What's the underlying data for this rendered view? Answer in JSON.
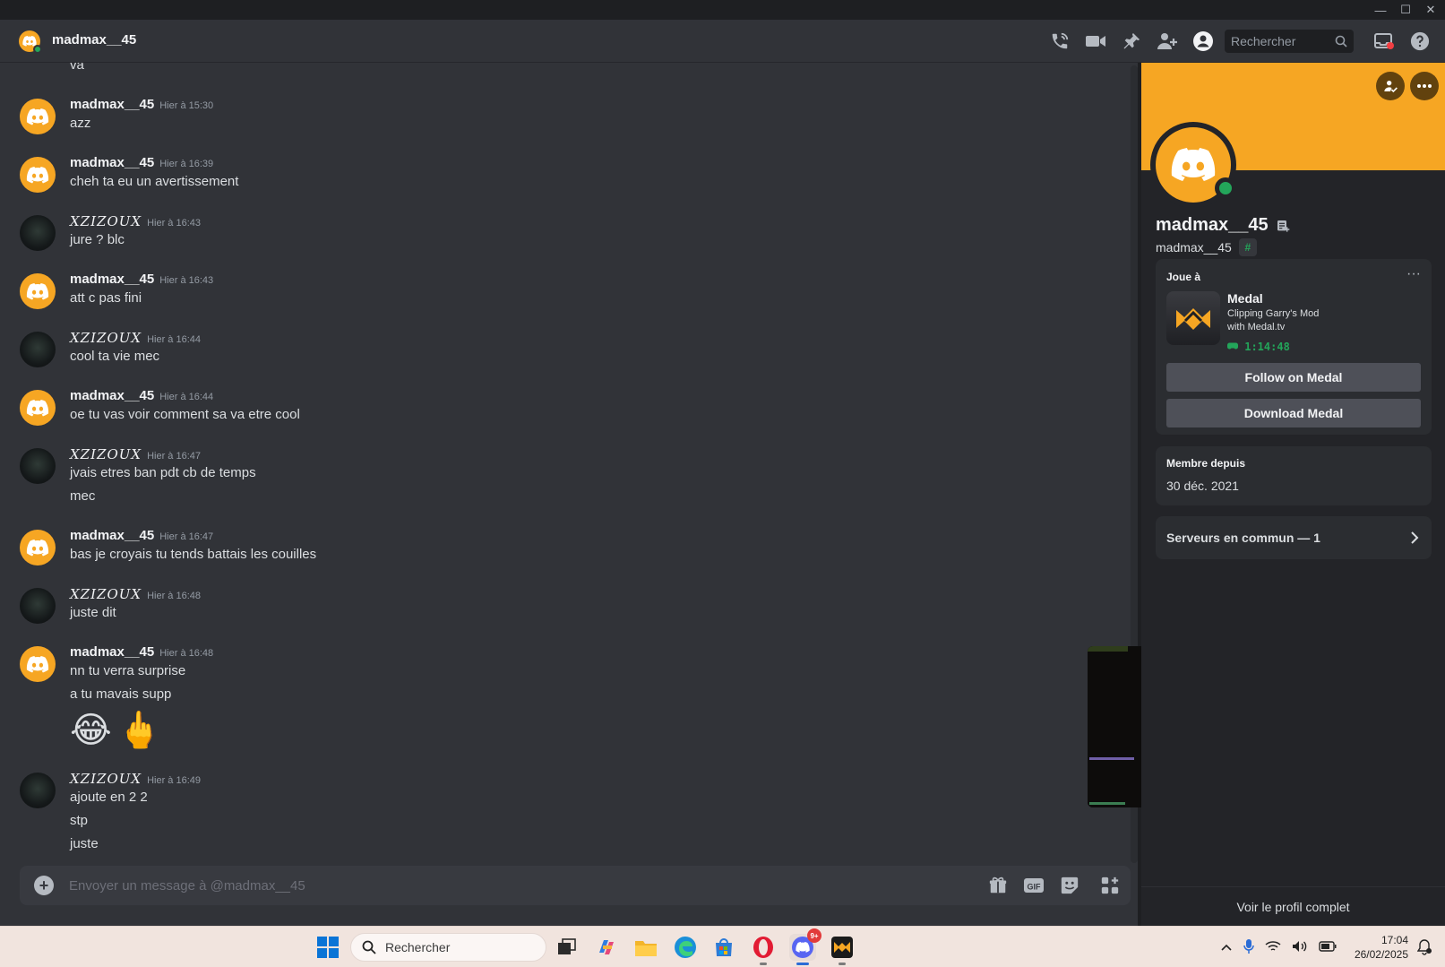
{
  "window": {
    "controls": [
      "—",
      "☐",
      "✕"
    ]
  },
  "header": {
    "name": "madmax__45",
    "search_placeholder": "Rechercher"
  },
  "messages": [
    {
      "type": "continuation",
      "lines": [
        "va"
      ]
    },
    {
      "user": "madmax__45",
      "style": "orange",
      "time": "Hier à 15:30",
      "lines": [
        "azz"
      ]
    },
    {
      "user": "madmax__45",
      "style": "orange",
      "time": "Hier à 16:39",
      "lines": [
        "cheh ta eu un avertissement"
      ]
    },
    {
      "user": "ΧΖΙΖΟUΧ",
      "style": "dark",
      "time": "Hier à 16:43",
      "lines": [
        "jure ? blc"
      ]
    },
    {
      "user": "madmax__45",
      "style": "orange",
      "time": "Hier à 16:43",
      "lines": [
        "att c pas fini"
      ]
    },
    {
      "user": "ΧΖΙΖΟUΧ",
      "style": "dark",
      "time": "Hier à 16:44",
      "lines": [
        "cool ta vie mec"
      ]
    },
    {
      "user": "madmax__45",
      "style": "orange",
      "time": "Hier à 16:44",
      "lines": [
        "oe tu vas voir comment sa va etre cool"
      ]
    },
    {
      "user": "ΧΖΙΖΟUΧ",
      "style": "dark",
      "time": "Hier à 16:47",
      "lines": [
        "jvais etres ban pdt cb de temps",
        "mec"
      ]
    },
    {
      "user": "madmax__45",
      "style": "orange",
      "time": "Hier à 16:47",
      "lines": [
        "bas je croyais tu tends battais les couilles"
      ]
    },
    {
      "user": "ΧΖΙΖΟUΧ",
      "style": "dark",
      "time": "Hier à 16:48",
      "lines": [
        "juste dit"
      ]
    },
    {
      "user": "madmax__45",
      "style": "orange",
      "time": "Hier à 16:48",
      "lines": [
        "nn tu verra surprise",
        "a tu mavais supp"
      ],
      "emojis": [
        "😂",
        "🖕"
      ]
    },
    {
      "user": "ΧΖΙΖΟUΧ",
      "style": "dark",
      "time": "Hier à 16:49",
      "lines": [
        "ajoute en 2 2",
        "stp",
        "juste"
      ]
    }
  ],
  "composer": {
    "placeholder": "Envoyer un message à @madmax__45"
  },
  "profile": {
    "display_name": "madmax__45",
    "username": "madmax__45",
    "activity": {
      "title": "Joue à",
      "app": "Medal",
      "details_1": "Clipping Garry's Mod",
      "details_2": "with Medal.tv",
      "elapsed": "1:14:48",
      "button_follow": "Follow on Medal",
      "button_download": "Download Medal"
    },
    "member_since_title": "Membre depuis",
    "member_since": "30 déc. 2021",
    "mutual_servers": "Serveurs en commun — 1",
    "full_profile": "Voir le profil complet"
  },
  "colors": {
    "brand_orange": "#f6a623",
    "online_green": "#23a55a",
    "chat_bg": "#313338",
    "panel_bg": "#232428"
  },
  "taskbar": {
    "search": "Rechercher",
    "notification_badge": "9+",
    "time": "17:04",
    "date": "26/02/2025"
  }
}
